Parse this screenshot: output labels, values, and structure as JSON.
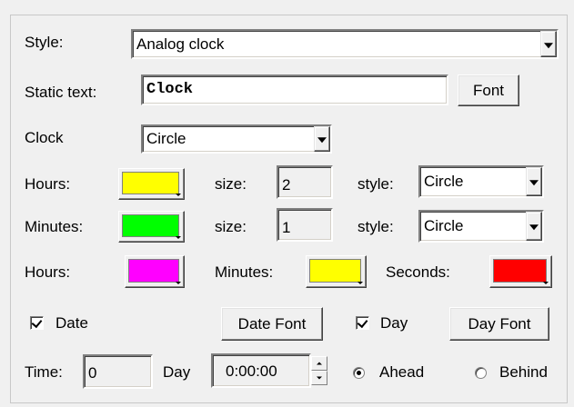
{
  "style": {
    "label": "Style:",
    "value": "Analog clock"
  },
  "static_text": {
    "label": "Static text:",
    "value": "Clock",
    "font_button": "Font"
  },
  "clock": {
    "label": "Clock",
    "value": "Circle"
  },
  "hours_row": {
    "label": "Hours:",
    "color": "#ffff00",
    "size_label": "size:",
    "size_value": "2",
    "style_label": "style:",
    "style_value": "Circle"
  },
  "minutes_row": {
    "label": "Minutes:",
    "color": "#00ff00",
    "size_label": "size:",
    "size_value": "1",
    "style_label": "style:",
    "style_value": "Circle"
  },
  "colors_row": {
    "hours_label": "Hours:",
    "hours_color": "#ff00ff",
    "minutes_label": "Minutes:",
    "minutes_color": "#ffff00",
    "seconds_label": "Seconds:",
    "seconds_color": "#ff0000"
  },
  "date_row": {
    "date_label": "Date",
    "date_checked": true,
    "date_font_button": "Date Font",
    "day_label": "Day",
    "day_checked": true,
    "day_font_button": "Day Font"
  },
  "time_row": {
    "time_label": "Time:",
    "time_value": "0",
    "day_label": "Day",
    "offset_value": "0:00:00",
    "ahead_label": "Ahead",
    "ahead_selected": true,
    "behind_label": "Behind",
    "behind_selected": false
  }
}
